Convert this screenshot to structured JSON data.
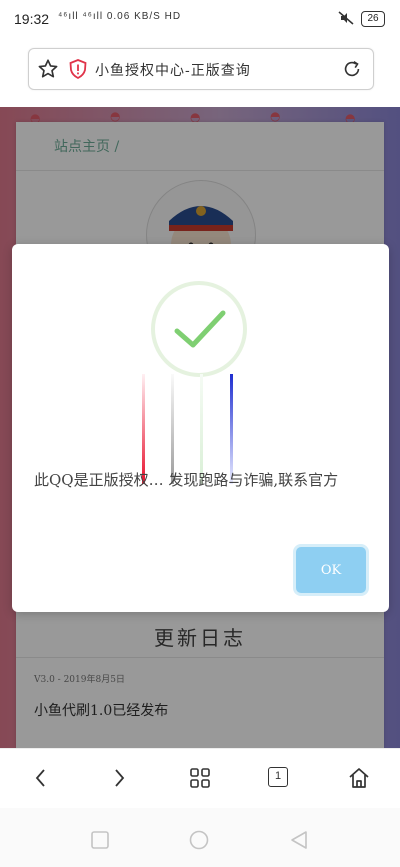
{
  "status_bar": {
    "time": "19:32",
    "network": "⁴⁶ıll ⁴⁶ıll 0.06 KB/S HD",
    "battery": "26",
    "icons": [
      "mute-icon",
      "battery-icon"
    ]
  },
  "browser": {
    "page_title": "小鱼授权中心-正版查询",
    "icons": [
      "star-icon",
      "shield-warning-icon",
      "reload-icon"
    ]
  },
  "page": {
    "breadcrumb": "站点主页 /",
    "update_log_title": "更新日志",
    "log_date": "V3.0 - 2019年8月5日",
    "log_entry": "小鱼代刷1.0已经发布"
  },
  "dialog": {
    "message": "此QQ是正版授权… 发现跑路与诈骗,联系官方",
    "ok_label": "OK",
    "icons": [
      "checkmark-icon"
    ]
  },
  "bottom_nav": {
    "icons": [
      "back-icon",
      "forward-icon",
      "grid-menu-icon",
      "tabs-icon",
      "home-icon"
    ],
    "tab_count": "1"
  },
  "system_nav": {
    "icons": [
      "recents-icon",
      "home-circle-icon",
      "back-triangle-icon"
    ]
  },
  "colors": {
    "accent": "#8ecff2",
    "check": "#7fcf72",
    "gradient_left": "#e07a8e",
    "gradient_right": "#8a86d6"
  }
}
